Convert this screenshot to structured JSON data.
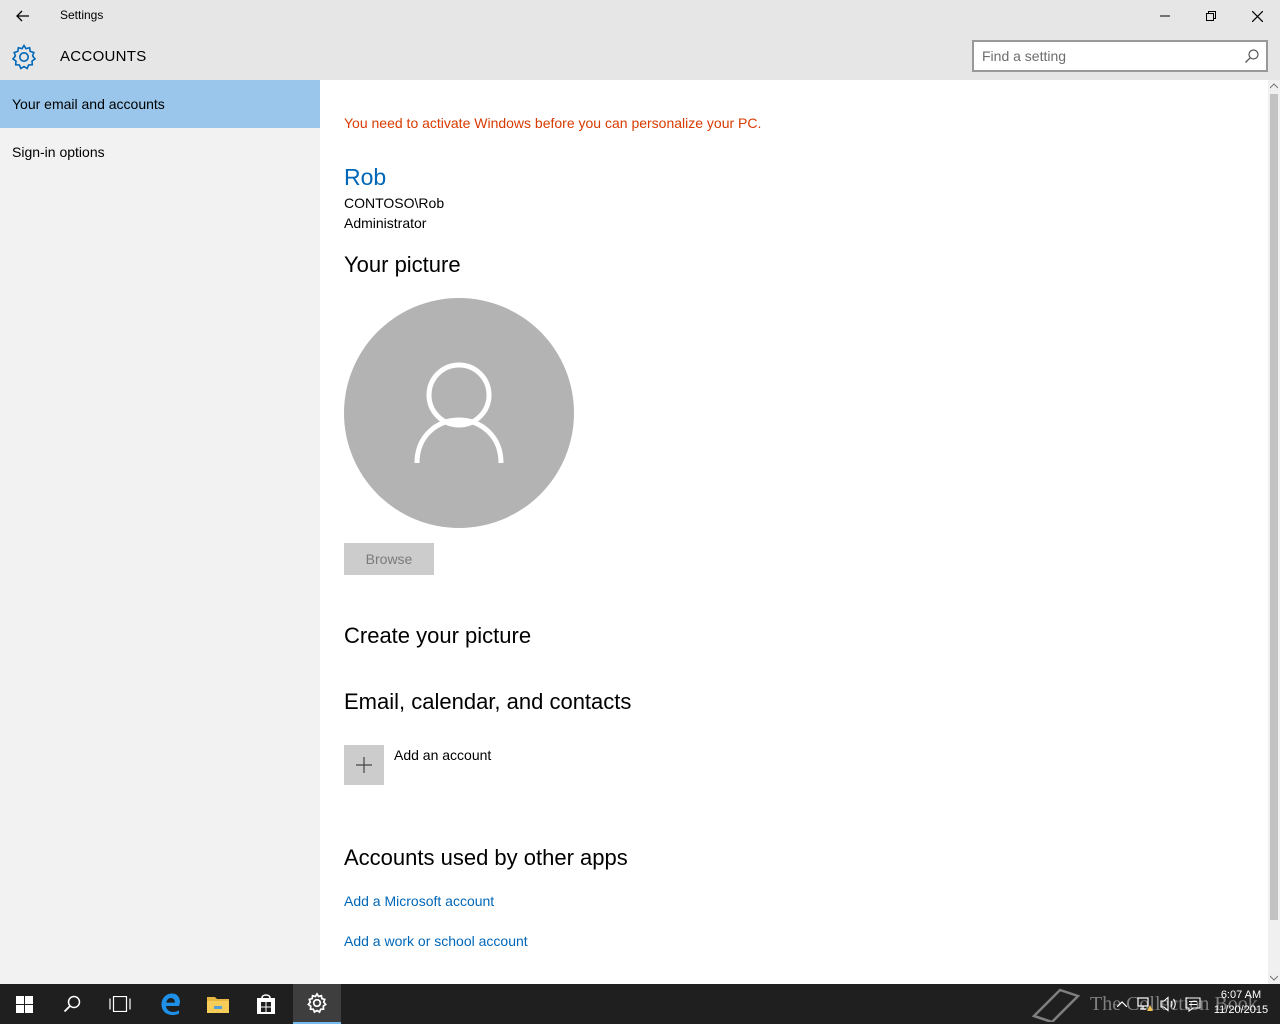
{
  "window": {
    "title": "Settings"
  },
  "header": {
    "section_title": "ACCOUNTS",
    "search_placeholder": "Find a setting"
  },
  "sidebar": {
    "items": [
      {
        "label": "Your email and accounts",
        "active": true
      },
      {
        "label": "Sign-in options",
        "active": false
      }
    ]
  },
  "main": {
    "warning": "You need to activate Windows before you can personalize your PC.",
    "user": {
      "name": "Rob",
      "domain": "CONTOSO\\Rob",
      "role": "Administrator"
    },
    "picture_heading": "Your picture",
    "browse_label": "Browse",
    "create_picture_heading": "Create your picture",
    "email_heading": "Email, calendar, and contacts",
    "add_account_label": "Add an account",
    "other_apps_heading": "Accounts used by other apps",
    "links": {
      "microsoft": "Add a Microsoft account",
      "work_school": "Add a work or school account"
    }
  },
  "taskbar": {
    "time": "6:07 AM",
    "date": "11/20/2015",
    "watermark": "The Collection Book"
  },
  "colors": {
    "accent": "#0067b8",
    "warning": "#d83b01",
    "nav_active": "#99c6ea",
    "chrome": "#e6e6e6",
    "taskbar": "#1f1f1f"
  }
}
